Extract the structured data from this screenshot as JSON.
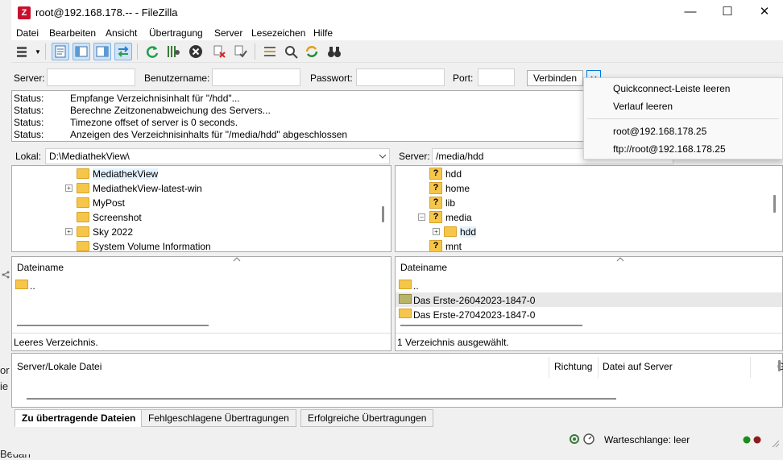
{
  "window": {
    "title": "root@192.168.178.-- - FileZilla",
    "minimize": "—",
    "maximize": "☐",
    "close": "✕"
  },
  "menu": [
    "Datei",
    "Bearbeiten",
    "Ansicht",
    "Übertragung",
    "Server",
    "Lesezeichen",
    "Hilfe"
  ],
  "quickconnect": {
    "server_label": "Server:",
    "server_value": "",
    "user_label": "Benutzername:",
    "user_value": "",
    "pass_label": "Passwort:",
    "pass_value": "",
    "port_label": "Port:",
    "port_value": "",
    "connect_label": "Verbinden"
  },
  "dropdown": {
    "items": [
      "Quickconnect-Leiste leeren",
      "Verlauf leeren",
      "root@192.168.178.25",
      "ftp://root@192.168.178.25"
    ]
  },
  "log": [
    {
      "key": "Status:",
      "text": "Empfange Verzeichnisinhalt für \"/hdd\"..."
    },
    {
      "key": "Status:",
      "text": "Berechne Zeitzonenabweichung des Servers..."
    },
    {
      "key": "Status:",
      "text": "Timezone offset of server is 0 seconds."
    },
    {
      "key": "Status:",
      "text": "Anzeigen des Verzeichnisinhalts für \"/media/hdd\" abgeschlossen"
    }
  ],
  "local": {
    "path_label": "Lokal:",
    "path": "D:\\MediathekView\\",
    "tree": [
      {
        "name": "MediathekView",
        "expand": false,
        "selected": true
      },
      {
        "name": "MediathekView-latest-win",
        "expand": true
      },
      {
        "name": "MyPost",
        "expand": false
      },
      {
        "name": "Screenshot",
        "expand": false
      },
      {
        "name": "Sky 2022",
        "expand": true
      },
      {
        "name": "System Volume Information",
        "expand": false
      }
    ],
    "col_filename": "Dateiname",
    "files": [
      ".."
    ],
    "status": "Leeres Verzeichnis."
  },
  "remote": {
    "path_label": "Server:",
    "path": "/media/hdd",
    "tree": [
      {
        "name": "hdd",
        "type": "q"
      },
      {
        "name": "home",
        "type": "q"
      },
      {
        "name": "lib",
        "type": "q"
      },
      {
        "name": "media",
        "type": "q",
        "expanded": true
      },
      {
        "name": "hdd",
        "type": "folder",
        "indent": true,
        "plus": true,
        "selected": true
      },
      {
        "name": "mnt",
        "type": "q"
      }
    ],
    "col_filename": "Dateiname",
    "files": [
      "..",
      "Das Erste-26042023-1847-0",
      "Das Erste-27042023-1847-0"
    ],
    "status": "1 Verzeichnis ausgewählt."
  },
  "queue": {
    "col1": "Server/Lokale Datei",
    "col2": "Richtung",
    "col3": "Datei auf Server",
    "col4": "G"
  },
  "tabs": [
    "Zu übertragende Dateien",
    "Fehlgeschlagene Übertragungen",
    "Erfolgreiche Übertragungen"
  ],
  "statusbar": {
    "queue": "Warteschlange: leer"
  },
  "background_fragments": [
    "or",
    "ie",
    "Bedarf"
  ],
  "colors": {
    "folder": "#f6c64a",
    "accent": "#0078d7",
    "filezilla_red": "#c8102e"
  }
}
